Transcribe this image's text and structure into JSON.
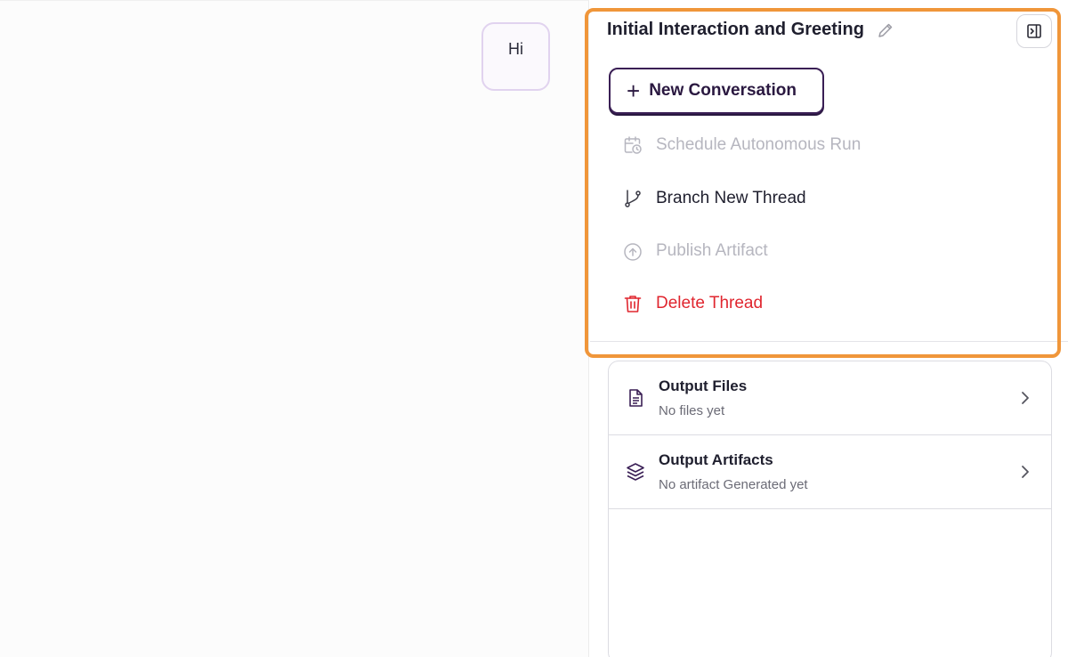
{
  "chat": {
    "user_message": "Hi"
  },
  "thread": {
    "title": "Initial Interaction and Greeting"
  },
  "actions": {
    "new_conversation": "New Conversation",
    "schedule_run": "Schedule Autonomous Run",
    "branch_thread": "Branch New Thread",
    "publish_artifact": "Publish Artifact",
    "delete_thread": "Delete Thread"
  },
  "outputs": {
    "files": {
      "title": "Output Files",
      "subtitle": "No files yet"
    },
    "artifacts": {
      "title": "Output Artifacts",
      "subtitle": "No artifact Generated yet"
    }
  },
  "icons": {
    "edit": "pencil-icon",
    "collapse": "sidebar-collapse-icon",
    "add": "plus-icon",
    "schedule": "calendar-clock-icon",
    "branch": "git-branch-icon",
    "publish": "arrow-up-circle-icon",
    "delete": "trash-icon",
    "files": "file-icon",
    "artifacts": "layers-icon",
    "expand": "chevron-right-icon"
  },
  "colors": {
    "accent": "#3a1f55",
    "danger": "#e0262f",
    "disabled": "#b6b6bf",
    "highlight": "#f0963a"
  }
}
